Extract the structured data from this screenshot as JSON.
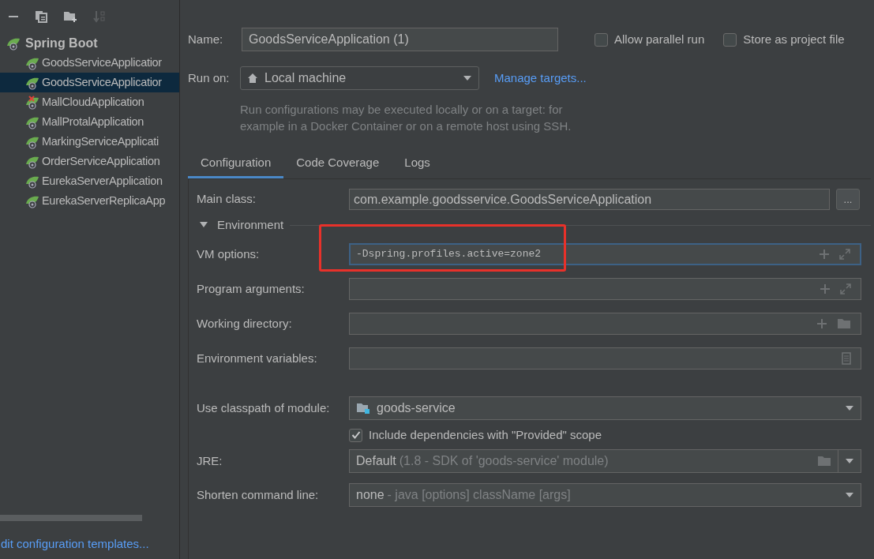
{
  "sidebar": {
    "toolbar": [
      {
        "kind": "minus",
        "disabled": false
      },
      {
        "kind": "copy",
        "disabled": false
      },
      {
        "kind": "folder",
        "disabled": false
      },
      {
        "kind": "sort",
        "disabled": true
      }
    ],
    "tree": {
      "label": "Spring Boot",
      "children": [
        {
          "label": "GoodsServiceApplicatior",
          "selected": false,
          "error": false
        },
        {
          "label": "GoodsServiceApplicatior",
          "selected": true,
          "error": false
        },
        {
          "label": "MallCloudApplication",
          "selected": false,
          "error": true
        },
        {
          "label": "MallProtalApplication",
          "selected": false,
          "error": false
        },
        {
          "label": "MarkingServiceApplicati",
          "selected": false,
          "error": false
        },
        {
          "label": "OrderServiceApplication",
          "selected": false,
          "error": false
        },
        {
          "label": "EurekaServerApplication",
          "selected": false,
          "error": false
        },
        {
          "label": "EurekaServerReplicaApp",
          "selected": false,
          "error": false
        }
      ]
    },
    "link": "dit configuration templates..."
  },
  "name": {
    "label": "Name:",
    "value": "GoodsServiceApplication (1)"
  },
  "options": [
    {
      "label": "Allow parallel run",
      "checked": false
    },
    {
      "label": "Store as project file",
      "checked": false
    }
  ],
  "run_on": {
    "label": "Run on:",
    "value": "Local machine",
    "link": "Manage targets...",
    "hint": "Run configurations may be executed locally or on a target: for example in a Docker Container or on a remote host using SSH."
  },
  "tabs": [
    {
      "label": "Configuration",
      "selected": true
    },
    {
      "label": "Code Coverage",
      "selected": false
    },
    {
      "label": "Logs",
      "selected": false
    }
  ],
  "main_class": {
    "label": "Main class:",
    "value": "com.example.goodsservice.GoodsServiceApplication",
    "button": "..."
  },
  "environment": {
    "label": "Environment",
    "expanded": true
  },
  "fields": [
    {
      "label": "VM options:",
      "value": "-Dspring.profiles.active=zone2",
      "focused": true,
      "highlighted": true,
      "kind": "expand"
    },
    {
      "label": "Program arguments:",
      "focused": false,
      "highlighted": false,
      "kind": "expand"
    },
    {
      "label": "Working directory:",
      "focused": false,
      "highlighted": false,
      "kind": "folder"
    },
    {
      "label": "Environment variables:",
      "focused": false,
      "highlighted": false,
      "kind": "doc"
    }
  ],
  "module": {
    "label": "Use classpath of module:",
    "value": "goods-service"
  },
  "include": {
    "label": "Include dependencies with \"Provided\" scope",
    "checked": true
  },
  "jre": {
    "label": "JRE:",
    "value": "Default",
    "detail": "(1.8 - SDK of 'goods-service' module)"
  },
  "shorten": {
    "label": "Shorten command line:",
    "value": "none",
    "detail": "- java [options] className [args]"
  }
}
